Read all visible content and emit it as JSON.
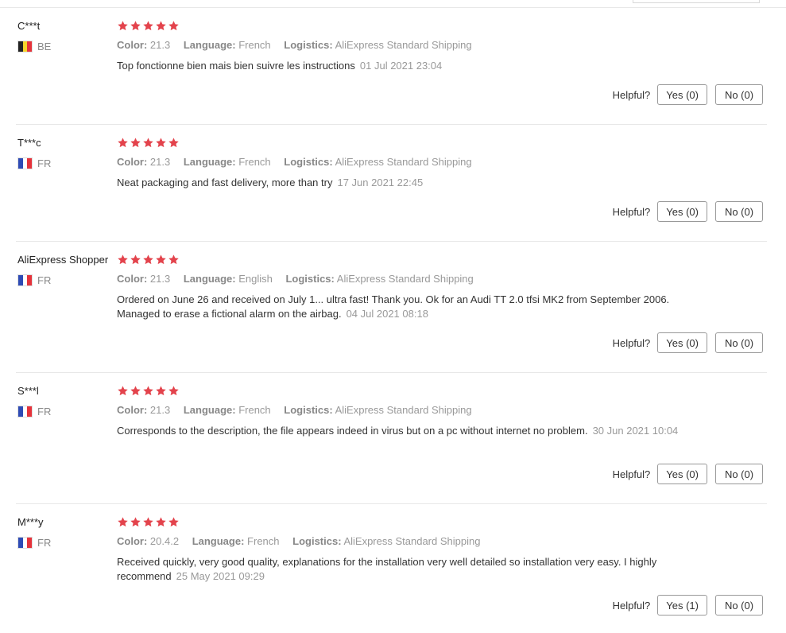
{
  "helpful_label": "Helpful?",
  "star_color": "#e3434c",
  "labels": {
    "color": "Color:",
    "language": "Language:",
    "logistics": "Logistics:"
  },
  "reviews": [
    {
      "user": "C***t",
      "country": "BE",
      "rating": 5,
      "color": "21.3",
      "language": "French",
      "logistics": "AliExpress Standard Shipping",
      "text": "Top fonctionne bien mais bien suivre les instructions",
      "date": "01 Jul 2021 23:04",
      "yes": "Yes (0)",
      "no": "No (0)"
    },
    {
      "user": "T***c",
      "country": "FR",
      "rating": 5,
      "color": "21.3",
      "language": "French",
      "logistics": "AliExpress Standard Shipping",
      "text": "Neat packaging and fast delivery, more than try",
      "date": "17 Jun 2021 22:45",
      "yes": "Yes (0)",
      "no": "No (0)"
    },
    {
      "user": "AliExpress Shopper",
      "country": "FR",
      "rating": 5,
      "color": "21.3",
      "language": "English",
      "logistics": "AliExpress Standard Shipping",
      "text": "Ordered on June 26 and received on July 1... ultra fast! Thank you. Ok for an Audi TT 2.0 tfsi MK2 from September 2006. Managed to erase a fictional alarm on the airbag.",
      "date": "04 Jul 2021 08:18",
      "yes": "Yes (0)",
      "no": "No (0)"
    },
    {
      "user": "S***l",
      "country": "FR",
      "rating": 5,
      "color": "21.3",
      "language": "French",
      "logistics": "AliExpress Standard Shipping",
      "text": "Corresponds to the description, the file appears indeed in virus but on a pc without internet no problem.",
      "date": "30 Jun 2021 10:04",
      "yes": "Yes (0)",
      "no": "No (0)"
    },
    {
      "user": "M***y",
      "country": "FR",
      "rating": 5,
      "color": "20.4.2",
      "language": "French",
      "logistics": "AliExpress Standard Shipping",
      "text": "Received quickly, very good quality, explanations for the installation very well detailed so installation very easy. I highly recommend",
      "date": "25 May 2021 09:29",
      "yes": "Yes (1)",
      "no": "No (0)"
    }
  ]
}
